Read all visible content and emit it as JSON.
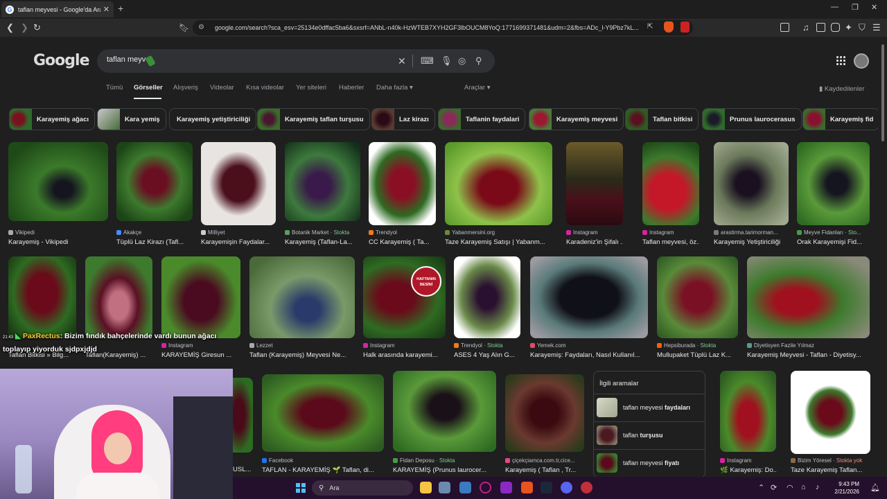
{
  "browser": {
    "tab_title": "taflan meyvesi - Google'da Ara",
    "tab_close": "✕",
    "new_tab": "+",
    "url": "google.com/search?sca_esv=25134e0dffac5ba6&sxsrf=ANbL-n40k-HzWTEB7XYH2GF3lbOUCM8YoQ:1771699371481&udm=2&fbs=ADc_l-Y9Pbz7kL..."
  },
  "google": {
    "logo": "Google",
    "search_value": "taflan meyve",
    "nav_tabs": [
      "Tümü",
      "Görseller",
      "Alışveriş",
      "Videolar",
      "Kısa videolar",
      "Yer siteleri",
      "Haberler",
      "Daha fazla ▾",
      "Araçlar ▾"
    ],
    "saved": "Kaydedilenler"
  },
  "chips": [
    "Karayemiş ağacı",
    "Kara yemiş",
    "Karayemiş yetiştiriciliği",
    "Karayemiş taflan turşusu",
    "Laz kirazı",
    "Taflanin faydalari",
    "Karayemiş meyvesi",
    "Taflan bitkisi",
    "Prunus laurocerasus",
    "Karayemiş fid"
  ],
  "row1": [
    {
      "source": "Vikipedi",
      "stock": "",
      "caption": "Karayemiş - Vikipedi"
    },
    {
      "source": "Akakçe",
      "stock": "",
      "caption": "Tüplü Laz Kirazı (Tafl..."
    },
    {
      "source": "Milliyet",
      "stock": "",
      "caption": "Karayemişin Faydalar..."
    },
    {
      "source": "Botanik Market",
      "stock": "Stokta",
      "caption": "Karayemiş (Taflan-La..."
    },
    {
      "source": "Trendyol",
      "stock": "",
      "caption": "CC Karayemiş ( Ta..."
    },
    {
      "source": "Yabanmersini.org",
      "stock": "",
      "caption": "Taze Karayemiş Satışı | Yabanm..."
    },
    {
      "source": "Instagram",
      "stock": "",
      "caption": "Karadeniz'in Şifalı ..."
    },
    {
      "source": "Instagram",
      "stock": "",
      "caption": "Taflan meyvesi, öz..."
    },
    {
      "source": "arastirma.tarimorman...",
      "stock": "",
      "caption": "Karayemiş Yetiştiriciliği"
    },
    {
      "source": "Meyve Fidanları",
      "stock": "Sto...",
      "caption": "Orak Karayemişi Fid..."
    }
  ],
  "row2": [
    {
      "source": "",
      "stock": "",
      "caption": "Taflan Bitkisi » Bilg..."
    },
    {
      "source": "",
      "stock": "",
      "caption": "Taflan(Karayemiş) ..."
    },
    {
      "source": "Instagram",
      "stock": "",
      "caption": "KARAYEMİŞ Giresun ..."
    },
    {
      "source": "Lezzet",
      "stock": "",
      "caption": "Taflan (Karayemiş) Meyvesi Ne..."
    },
    {
      "source": "Instagram",
      "stock": "",
      "caption": "Halk arasında karayemi..."
    },
    {
      "source": "Trendyol",
      "stock": "Stokta",
      "caption": "ASES 4 Yaş Alın G..."
    },
    {
      "source": "Yemek.com",
      "stock": "",
      "caption": "Karayemiş: Faydaları, Nasıl Kullanıl..."
    },
    {
      "source": "Hepsiburada",
      "stock": "Stokta",
      "caption": "Mullupaket Tüplü Laz K..."
    },
    {
      "source": "Diyetisyen Fazile Yılmaz",
      "stock": "",
      "caption": "Karayemiş Meyvesi - Taflan - Diyetisy..."
    }
  ],
  "row2_badge": "HAFTANIN BESİNİ",
  "row3": [
    {
      "source": "",
      "stock": "",
      "caption": "USL..."
    },
    {
      "source": "Facebook",
      "stock": "",
      "caption": "TAFLAN - KARAYEMİŞ 🌱 Taflan, di..."
    },
    {
      "source": "Fidan Deposu",
      "stock": "Stokta",
      "caption": "KARAYEMİŞ (Prunus laurocer..."
    },
    {
      "source": "çiçekçiamca.com.tr,cice...",
      "stock": "",
      "caption": "Karayemiş ( Taflan , Tr..."
    },
    {
      "source": "Instagram",
      "stock": "",
      "caption": "🌿 Karayemiş: Do..."
    },
    {
      "source": "Bizim Yöresel",
      "stock": "Stokta yok",
      "caption": "Taze Karayemiş Taflan..."
    }
  ],
  "related": {
    "title": "İlgili aramalar",
    "items": [
      {
        "plain": "taflan meyvesi ",
        "bold": "faydaları"
      },
      {
        "plain": "taflan ",
        "bold": "turşusu"
      },
      {
        "plain": "taflan meyvesi ",
        "bold": "fiyatı"
      }
    ]
  },
  "chat": {
    "time": "21:43",
    "user": "PaxRectus",
    "message": ": Bizim fındık bahçelerinde vardı bunun ağacı toplayıp yiyorduk sjdpxjdjd"
  },
  "taskbar": {
    "search_placeholder": "Ara",
    "time": "9:43 PM",
    "date": "2/21/2026"
  },
  "colors": {
    "background": "#1f1f1f",
    "berry_red": "#7a1020",
    "leaf_green": "#2e6b2a",
    "stock_green": "#81c995",
    "stock_red": "#f28b82"
  }
}
